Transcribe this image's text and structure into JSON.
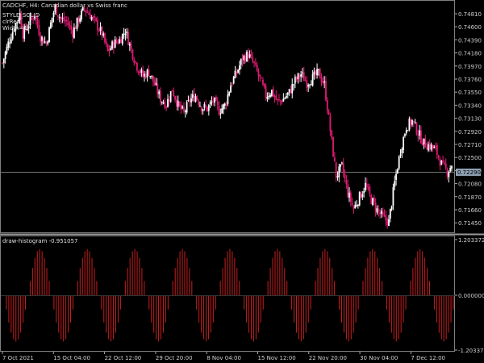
{
  "window": {
    "title": "CADCHF,  H4:  Canadian dollar vs Swiss franc",
    "style_lines": [
      "STYLE_SOLID",
      "clrRed",
      "Width=1"
    ]
  },
  "colors": {
    "background": "#000000",
    "bull_candle": "#ffffff",
    "bear_candle": "#e01a73",
    "frame": "#808080",
    "histogram": "#c81e1e",
    "current_price_label_bg": "#8fa0b4"
  },
  "indicator": {
    "label": "draw-histogram -0.951057"
  },
  "price_axis": {
    "ticks": [
      "0.74810",
      "0.74600",
      "0.74390",
      "0.74180",
      "0.73970",
      "0.73760",
      "0.73550",
      "0.73340",
      "0.73130",
      "0.72920",
      "0.72710",
      "0.72500",
      "0.72290",
      "0.72080",
      "0.71870",
      "0.71660",
      "0.71450"
    ],
    "current_price": "0.72290"
  },
  "indicator_axis": {
    "ticks": [
      "1.203372",
      "0.000000",
      "-1.203372"
    ]
  },
  "time_axis": {
    "labels": [
      "7 Oct 2021",
      "15 Oct 04:00",
      "22 Oct 12:00",
      "29 Oct 20:00",
      "8 Nov 04:00",
      "15 Nov 12:00",
      "22 Nov 20:00",
      "30 Nov 04:00",
      "7 Dec 12:00"
    ]
  },
  "chart_data": [
    {
      "type": "candlestick",
      "title": "CADCHF, H4: Canadian dollar vs Swiss franc",
      "ylim": [
        0.7137,
        0.7489
      ],
      "x_labels": [
        "7 Oct 2021",
        "15 Oct 04:00",
        "22 Oct 12:00",
        "29 Oct 20:00",
        "8 Nov 04:00",
        "15 Nov 12:00",
        "22 Nov 20:00",
        "30 Nov 04:00",
        "7 Dec 12:00"
      ],
      "close_path": [
        [
          0,
          0.7395
        ],
        [
          4,
          0.7425
        ],
        [
          8,
          0.745
        ],
        [
          12,
          0.747
        ],
        [
          14,
          0.744
        ],
        [
          18,
          0.7455
        ],
        [
          22,
          0.747
        ],
        [
          26,
          0.7435
        ],
        [
          30,
          0.7425
        ],
        [
          34,
          0.7465
        ],
        [
          36,
          0.748
        ],
        [
          40,
          0.7462
        ],
        [
          44,
          0.7458
        ],
        [
          48,
          0.7442
        ],
        [
          52,
          0.7462
        ],
        [
          56,
          0.7478
        ],
        [
          60,
          0.7468
        ],
        [
          64,
          0.7455
        ],
        [
          68,
          0.744
        ],
        [
          72,
          0.7412
        ],
        [
          76,
          0.7425
        ],
        [
          80,
          0.743
        ],
        [
          84,
          0.7445
        ],
        [
          88,
          0.7415
        ],
        [
          92,
          0.739
        ],
        [
          96,
          0.7375
        ],
        [
          100,
          0.7382
        ],
        [
          104,
          0.7362
        ],
        [
          108,
          0.734
        ],
        [
          112,
          0.7332
        ],
        [
          116,
          0.7355
        ],
        [
          120,
          0.733
        ],
        [
          124,
          0.7318
        ],
        [
          128,
          0.7338
        ],
        [
          132,
          0.7345
        ],
        [
          136,
          0.7328
        ],
        [
          140,
          0.7325
        ],
        [
          144,
          0.7338
        ],
        [
          148,
          0.7322
        ],
        [
          152,
          0.733
        ],
        [
          156,
          0.7362
        ],
        [
          160,
          0.738
        ],
        [
          164,
          0.7402
        ],
        [
          168,
          0.7408
        ],
        [
          172,
          0.7392
        ],
        [
          176,
          0.737
        ],
        [
          180,
          0.7345
        ],
        [
          184,
          0.7352
        ],
        [
          188,
          0.7335
        ],
        [
          192,
          0.734
        ],
        [
          196,
          0.735
        ],
        [
          200,
          0.7368
        ],
        [
          204,
          0.7378
        ],
        [
          208,
          0.7365
        ],
        [
          212,
          0.7372
        ],
        [
          216,
          0.738
        ],
        [
          220,
          0.7362
        ],
        [
          224,
          0.7292
        ],
        [
          228,
          0.7222
        ],
        [
          232,
          0.7236
        ],
        [
          236,
          0.7196
        ],
        [
          240,
          0.7172
        ],
        [
          244,
          0.719
        ],
        [
          248,
          0.7208
        ],
        [
          252,
          0.7186
        ],
        [
          256,
          0.717
        ],
        [
          260,
          0.7158
        ],
        [
          264,
          0.7152
        ],
        [
          268,
          0.7212
        ],
        [
          272,
          0.7262
        ],
        [
          276,
          0.7298
        ],
        [
          280,
          0.7306
        ],
        [
          284,
          0.7288
        ],
        [
          288,
          0.7272
        ],
        [
          292,
          0.7268
        ],
        [
          296,
          0.7262
        ],
        [
          300,
          0.724
        ],
        [
          304,
          0.7228
        ],
        [
          307,
          0.724
        ]
      ]
    },
    {
      "type": "bar",
      "title": "draw-histogram -0.951057",
      "ylim": [
        -1.203372,
        1.203372
      ],
      "series": [
        {
          "function": "sine",
          "amplitude": 1.0,
          "period_bars": 20,
          "bar_count": 190
        }
      ]
    }
  ]
}
